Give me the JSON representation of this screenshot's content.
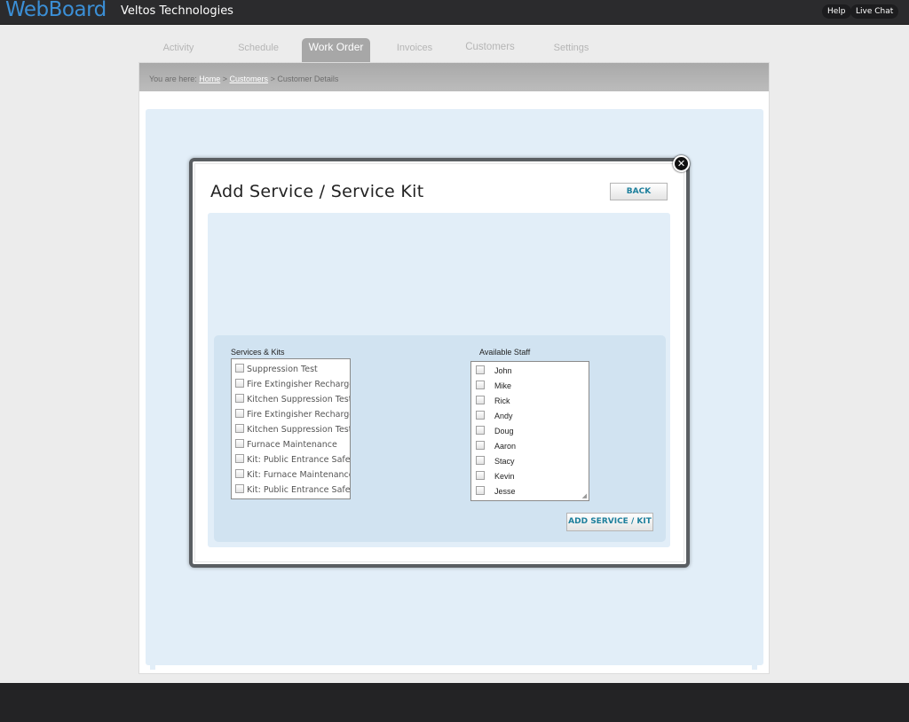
{
  "header": {
    "logo": "WebBoard",
    "company": "Veltos Technologies",
    "help_label": "Help",
    "chat_label": "Live Chat"
  },
  "tabs": [
    {
      "label": "Activity"
    },
    {
      "label": "Schedule"
    },
    {
      "label": "Work Order",
      "active": true
    },
    {
      "label": "Invoices"
    },
    {
      "label": "Customers"
    },
    {
      "label": "Settings"
    }
  ],
  "breadcrumb": {
    "prefix": "You are here:",
    "home": "Home",
    "sep": ">",
    "customers": "Customers",
    "current": "Customer Details"
  },
  "modal": {
    "title": "Add Service / Service Kit",
    "back_label": "BACK",
    "close_symbol": "✕",
    "services_label": "Services & Kits",
    "services": [
      "Suppression Test",
      "Fire Extingisher Recharge",
      "Kitchen Suppression Test",
      "Fire Extingisher Recharge",
      "Kitchen Suppression Test",
      "Furnace Maintenance",
      "Kit: Public Entrance Safetly",
      "Kit: Furnace Maintenance",
      "Kit: Public Entrance Safetly"
    ],
    "staff_label": "Available Staff",
    "staff": [
      "John",
      "Mike",
      "Rick",
      "Andy",
      "Doug",
      "Aaron",
      "Stacy",
      "Kevin",
      "Jesse"
    ],
    "add_label": "ADD SERVICE / KIT"
  },
  "colors": {
    "logo": "#3b8fd6",
    "accent_text": "#1d7f9c",
    "panel": "#e2eef8",
    "inner_panel": "#d1e3f1",
    "topbar": "#2b2b2d"
  }
}
